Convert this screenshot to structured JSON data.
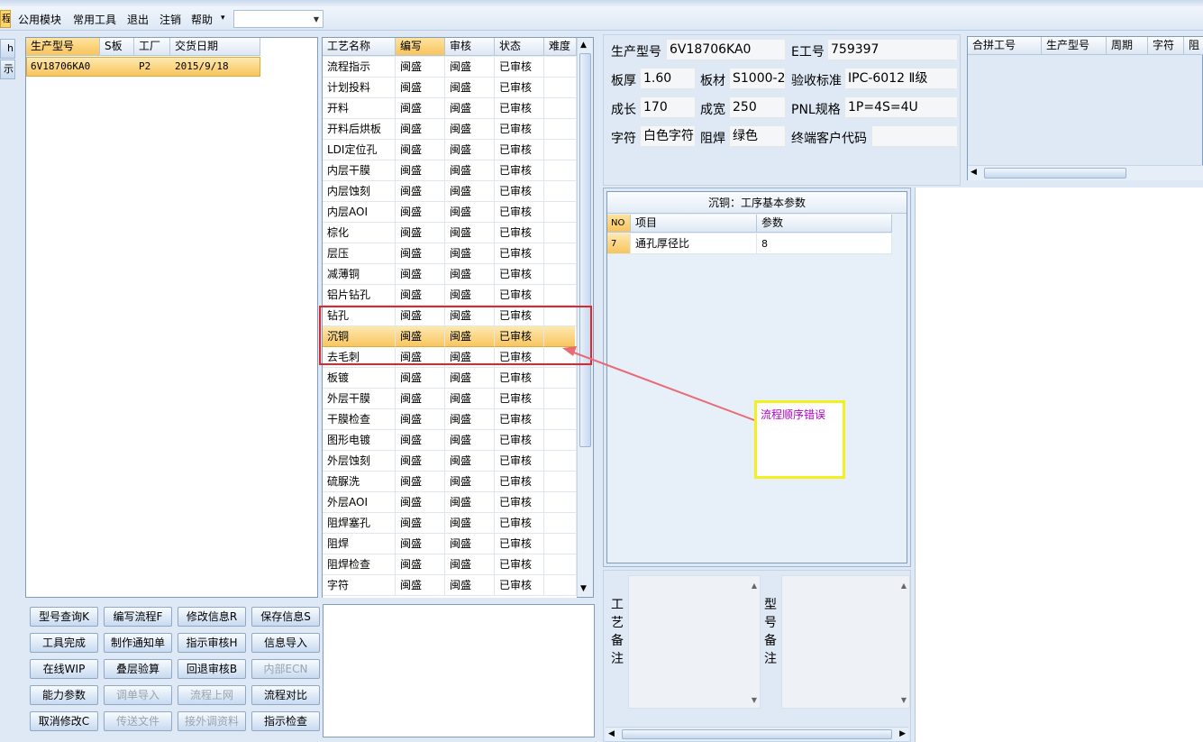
{
  "menu": {
    "first": "程",
    "items": [
      "公用模块",
      "常用工具",
      "退出",
      "注销",
      "帮助"
    ],
    "help_arrow": "▾",
    "combo_value": ""
  },
  "left_edge": {
    "items": [
      "h",
      "示"
    ]
  },
  "left_grid": {
    "headers": [
      "生产型号",
      "S板",
      "工厂",
      "交货日期"
    ],
    "rows": [
      [
        "6V18706KA0",
        "",
        "P2",
        "2015/9/18"
      ]
    ]
  },
  "flow_grid": {
    "headers": [
      "工艺名称",
      "编写",
      "审核",
      "状态",
      "难度"
    ],
    "rows": [
      [
        "流程指示",
        "闽盛",
        "闽盛",
        "已审核",
        ""
      ],
      [
        "计划投料",
        "闽盛",
        "闽盛",
        "已审核",
        ""
      ],
      [
        "开料",
        "闽盛",
        "闽盛",
        "已审核",
        ""
      ],
      [
        "开料后烘板",
        "闽盛",
        "闽盛",
        "已审核",
        ""
      ],
      [
        "LDI定位孔",
        "闽盛",
        "闽盛",
        "已审核",
        ""
      ],
      [
        "内层干膜",
        "闽盛",
        "闽盛",
        "已审核",
        ""
      ],
      [
        "内层蚀刻",
        "闽盛",
        "闽盛",
        "已审核",
        ""
      ],
      [
        "内层AOI",
        "闽盛",
        "闽盛",
        "已审核",
        ""
      ],
      [
        "棕化",
        "闽盛",
        "闽盛",
        "已审核",
        ""
      ],
      [
        "层压",
        "闽盛",
        "闽盛",
        "已审核",
        ""
      ],
      [
        "减薄铜",
        "闽盛",
        "闽盛",
        "已审核",
        ""
      ],
      [
        "铝片钻孔",
        "闽盛",
        "闽盛",
        "已审核",
        ""
      ],
      [
        "钻孔",
        "闽盛",
        "闽盛",
        "已审核",
        ""
      ],
      [
        "沉铜",
        "闽盛",
        "闽盛",
        "已审核",
        ""
      ],
      [
        "去毛刺",
        "闽盛",
        "闽盛",
        "已审核",
        ""
      ],
      [
        "板镀",
        "闽盛",
        "闽盛",
        "已审核",
        ""
      ],
      [
        "外层干膜",
        "闽盛",
        "闽盛",
        "已审核",
        ""
      ],
      [
        "干膜检查",
        "闽盛",
        "闽盛",
        "已审核",
        ""
      ],
      [
        "图形电镀",
        "闽盛",
        "闽盛",
        "已审核",
        ""
      ],
      [
        "外层蚀刻",
        "闽盛",
        "闽盛",
        "已审核",
        ""
      ],
      [
        "硫脲洗",
        "闽盛",
        "闽盛",
        "已审核",
        ""
      ],
      [
        "外层AOI",
        "闽盛",
        "闽盛",
        "已审核",
        ""
      ],
      [
        "阻焊塞孔",
        "闽盛",
        "闽盛",
        "已审核",
        ""
      ],
      [
        "阻焊",
        "闽盛",
        "闽盛",
        "已审核",
        ""
      ],
      [
        "阻焊检查",
        "闽盛",
        "闽盛",
        "已审核",
        ""
      ],
      [
        "字符",
        "闽盛",
        "闽盛",
        "已审核",
        ""
      ]
    ],
    "selected_index": 13
  },
  "buttons": [
    [
      "型号查询K",
      "编写流程F",
      "修改信息R",
      "保存信息S"
    ],
    [
      "工具完成",
      "制作通知单",
      "指示审核H",
      "信息导入"
    ],
    [
      "在线WIP",
      "叠层验算",
      "回退审核B",
      "内部ECN"
    ],
    [
      "能力参数",
      "调单导入",
      "流程上网",
      "流程对比"
    ],
    [
      "取消修改C",
      "传送文件",
      "接外调资料",
      "指示检查"
    ]
  ],
  "disabled_buttons": [
    "内部ECN",
    "调单导入",
    "流程上网",
    "传送文件",
    "接外调资料"
  ],
  "info": {
    "model_label": "生产型号",
    "model_value": "6V18706KA0",
    "e_label": "E工号",
    "e_value": "759397",
    "thick_label": "板厚",
    "thick_value": "1.60",
    "material_label": "板材",
    "material_value": "S1000-2",
    "std_label": "验收标准",
    "std_value": "IPC-6012 Ⅱ级",
    "len_label": "成长",
    "len_value": "170",
    "width_label": "成宽",
    "width_value": "250",
    "pnl_label": "PNL规格",
    "pnl_value": "1P=4S=4U",
    "char_label": "字符",
    "char_value": "白色字符",
    "mask_label": "阻焊",
    "mask_value": "绿色",
    "cust_label": "终端客户代码",
    "cust_value": ""
  },
  "merge_grid": {
    "headers": [
      "合拼工号",
      "生产型号",
      "周期",
      "字符",
      "阻"
    ]
  },
  "param_panel": {
    "title": "沉铜：工序基本参数",
    "headers": [
      "NO",
      "项目",
      "参数"
    ],
    "rows": [
      [
        "7",
        "通孔厚径比",
        "8"
      ]
    ]
  },
  "remarks": {
    "process_label": "工艺备注",
    "model_label": "型号备注"
  },
  "annotation": {
    "text": "流程顺序错误"
  },
  "colors": {
    "selection": "#f8c45c",
    "annotation_border": "#e0262a",
    "note_text": "#b400c8",
    "note_border": "#f3f020"
  }
}
